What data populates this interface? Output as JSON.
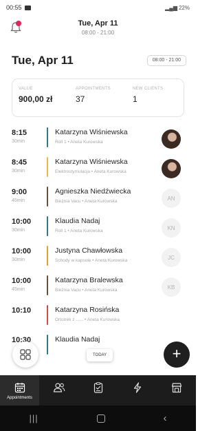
{
  "status_bar": {
    "time": "00:55",
    "battery": "22%"
  },
  "header": {
    "date": "Tue, Apr 11",
    "hours": "08:00 - 21:00",
    "notification_badge": true
  },
  "day": {
    "title": "Tue, Apr 11",
    "hours_chip": "08:00 - 21:00"
  },
  "stats": [
    {
      "label": "VALUE",
      "value": "900,00 zł"
    },
    {
      "label": "APPOINTMENTS",
      "value": "37"
    },
    {
      "label": "NEW CLIENTS",
      "value": "1"
    }
  ],
  "appointments": [
    {
      "time": "8:15",
      "duration": "30min",
      "name": "Katarzyna Wiśniewska",
      "service": "Roll 1 • Aneta Kurowska",
      "color": "#2f7a8a",
      "avatar": "photo"
    },
    {
      "time": "8:45",
      "duration": "30min",
      "name": "Katarzyna Wiśniewska",
      "service": "Elektrostymulacja • Aneta Kurowska",
      "color": "#e8b54a",
      "avatar": "photo"
    },
    {
      "time": "9:00",
      "duration": "45min",
      "name": "Agnieszka Niedźwiecka",
      "service": "Bieżnia Vacu • Aneta Kurowska",
      "color": "#6b4e3d",
      "avatar": "AN"
    },
    {
      "time": "10:00",
      "duration": "30min",
      "name": "Klaudia Nadaj",
      "service": "Roll 1 • Aneta Kurowska",
      "color": "#2f7a8a",
      "avatar": "KN"
    },
    {
      "time": "10:00",
      "duration": "30min",
      "name": "Justyna Chawłowska",
      "service": "Schody w kapsule • Aneta Kurowska",
      "color": "#e0a030",
      "avatar": "JC"
    },
    {
      "time": "10:00",
      "duration": "45min",
      "name": "Katarzyna Bralewska",
      "service": "Bieżnia Vacu • Aneta Kurowska",
      "color": "#6b4e3d",
      "avatar": "KB"
    },
    {
      "time": "10:10",
      "duration": "",
      "name": "Katarzyna Rosińska",
      "service": "Ortotrek z ...... • Aneta Kurowska",
      "color": "#d24a4a",
      "avatar": ""
    },
    {
      "time": "10:30",
      "duration": "",
      "name": "Klaudia Nadaj",
      "service": "",
      "color": "#2f7a8a",
      "avatar": ""
    }
  ],
  "today_button": "TODAY",
  "tabs": [
    {
      "label": "Appointments",
      "icon": "calendar-icon"
    },
    {
      "label": "",
      "icon": "clients-icon"
    },
    {
      "label": "",
      "icon": "clipboard-icon"
    },
    {
      "label": "",
      "icon": "lightning-icon"
    },
    {
      "label": "",
      "icon": "shop-icon"
    }
  ]
}
